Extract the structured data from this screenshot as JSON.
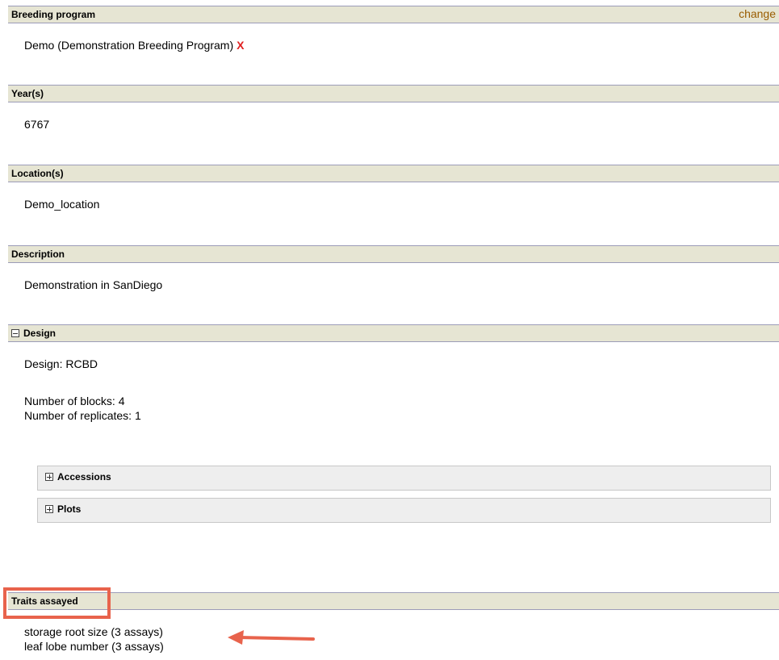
{
  "breeding_program": {
    "heading": "Breeding program",
    "change_label": "change",
    "value": "Demo (Demonstration Breeding Program)",
    "remove_label": "X"
  },
  "years": {
    "heading": "Year(s)",
    "value": "6767"
  },
  "locations": {
    "heading": "Location(s)",
    "value": "Demo_location"
  },
  "description": {
    "heading": "Description",
    "value": "Demonstration in SanDiego"
  },
  "design": {
    "heading": "Design",
    "design_line": "Design: RCBD",
    "blocks_line": "Number of blocks: 4",
    "replicates_line": "Number of replicates: 1",
    "accessions_label": "Accessions",
    "plots_label": "Plots"
  },
  "traits": {
    "heading": "Traits assayed",
    "items": [
      "storage root size (3 assays)",
      "leaf lobe number (3 assays)"
    ]
  },
  "colors": {
    "section_bar": "#e6e5d3",
    "annotation": "#e8634c",
    "remove": "#e02020",
    "link": "#9a5c00"
  }
}
